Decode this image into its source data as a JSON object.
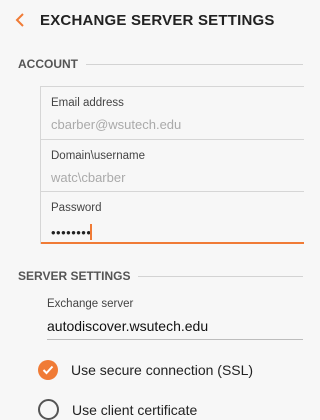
{
  "header": {
    "title": "EXCHANGE SERVER SETTINGS",
    "back_icon": "chevron-left-icon",
    "accent": "#f07b36"
  },
  "account": {
    "section_title": "ACCOUNT",
    "fields": [
      {
        "label": "Email address",
        "placeholder": "cbarber@wsutech.edu"
      },
      {
        "label": "Domain\\username",
        "placeholder": "watc\\cbarber"
      },
      {
        "label": "Password",
        "value": "••••••••"
      }
    ]
  },
  "server": {
    "section_title": "SERVER SETTINGS",
    "exchange_label": "Exchange server",
    "exchange_value": "autodiscover.wsutech.edu",
    "options": [
      {
        "label": "Use secure connection (SSL)",
        "checked": true
      },
      {
        "label": "Use client certificate",
        "checked": false
      }
    ]
  }
}
